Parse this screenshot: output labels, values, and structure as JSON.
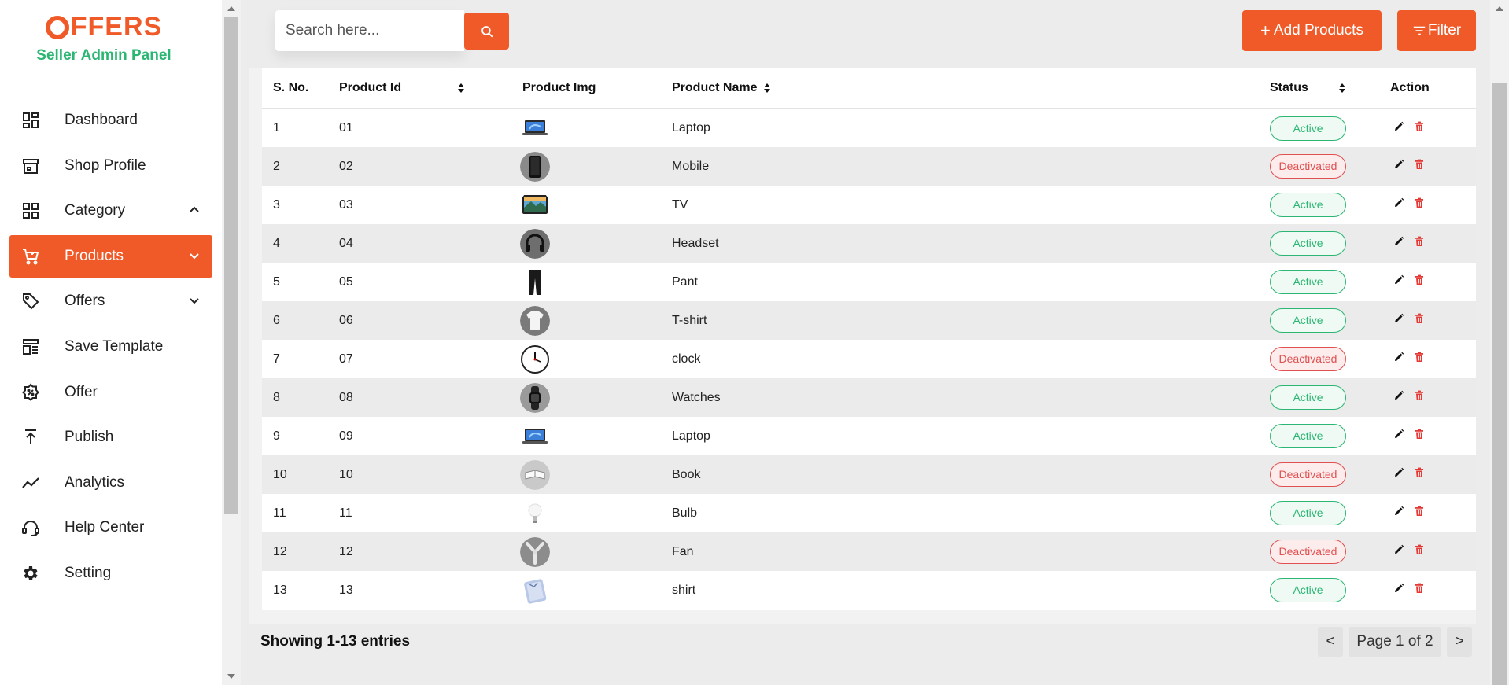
{
  "brand": {
    "logo_text": "FFERS",
    "subtitle": "Seller Admin Panel",
    "accent": "#f05a28",
    "green": "#2bb673"
  },
  "sidebar": {
    "items": [
      {
        "label": "Dashboard",
        "icon": "dashboard-icon"
      },
      {
        "label": "Shop Profile",
        "icon": "store-icon"
      },
      {
        "label": "Category",
        "icon": "category-grid-icon",
        "chevron": "up"
      },
      {
        "label": "Products",
        "icon": "cart-icon",
        "chevron": "down",
        "active": true
      },
      {
        "label": "Offers",
        "icon": "tag-icon",
        "chevron": "down"
      },
      {
        "label": "Save Template",
        "icon": "template-icon"
      },
      {
        "label": "Offer",
        "icon": "discount-badge-icon"
      },
      {
        "label": "Publish",
        "icon": "publish-upload-icon"
      },
      {
        "label": "Analytics",
        "icon": "trend-line-icon"
      },
      {
        "label": "Help Center",
        "icon": "headset-support-icon"
      },
      {
        "label": "Setting",
        "icon": "gear-icon"
      }
    ]
  },
  "toolbar": {
    "search_placeholder": "Search here...",
    "add_label": "Add Products",
    "add_prefix": "+",
    "filter_label": "Filter"
  },
  "table": {
    "columns": [
      "S. No.",
      "Product Id",
      "Product Img",
      "Product Name",
      "Status",
      "Action"
    ],
    "rows": [
      {
        "sno": "1",
        "id": "01",
        "img": "laptop",
        "name": "Laptop",
        "status": "Active"
      },
      {
        "sno": "2",
        "id": "02",
        "img": "mobile",
        "name": "Mobile",
        "status": "Deactivated"
      },
      {
        "sno": "3",
        "id": "03",
        "img": "tv",
        "name": "TV",
        "status": "Active"
      },
      {
        "sno": "4",
        "id": "04",
        "img": "headset",
        "name": "Headset",
        "status": "Active"
      },
      {
        "sno": "5",
        "id": "05",
        "img": "pant",
        "name": "Pant",
        "status": "Active"
      },
      {
        "sno": "6",
        "id": "06",
        "img": "tshirt",
        "name": "T-shirt",
        "status": "Active"
      },
      {
        "sno": "7",
        "id": "07",
        "img": "clock",
        "name": "clock",
        "status": "Deactivated"
      },
      {
        "sno": "8",
        "id": "08",
        "img": "watch",
        "name": "Watches",
        "status": "Active"
      },
      {
        "sno": "9",
        "id": "09",
        "img": "laptop",
        "name": "Laptop",
        "status": "Active"
      },
      {
        "sno": "10",
        "id": "10",
        "img": "book",
        "name": "Book",
        "status": "Deactivated"
      },
      {
        "sno": "11",
        "id": "11",
        "img": "bulb",
        "name": "Bulb",
        "status": "Active"
      },
      {
        "sno": "12",
        "id": "12",
        "img": "fan",
        "name": "Fan",
        "status": "Deactivated"
      },
      {
        "sno": "13",
        "id": "13",
        "img": "shirt",
        "name": "shirt",
        "status": "Active"
      }
    ]
  },
  "footer": {
    "showing": "Showing 1-13 entries",
    "prev": "<",
    "page_label": "Page 1 of 2",
    "next": ">"
  }
}
